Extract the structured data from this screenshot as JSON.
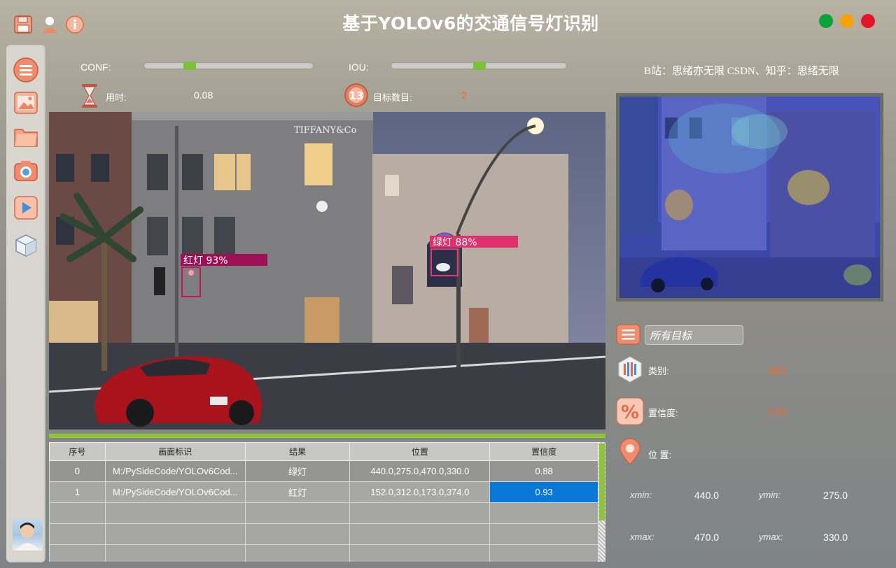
{
  "app": {
    "title": "基于YOLOv6的交通信号灯识别",
    "credits": "B站：思绪亦无限  CSDN、知乎：思绪无限"
  },
  "colors": {
    "accent_green": "#8dc43c",
    "value_orange": "#f06a28",
    "selection_blue": "#0a78d7",
    "window_close": "#e2152b",
    "window_min": "#f2a20c",
    "window_max": "#0aa23a"
  },
  "toolbar": {
    "icons": [
      "save-icon",
      "user-icon",
      "info-icon"
    ]
  },
  "sidebar": {
    "items": [
      {
        "name": "menu",
        "icon": "menu-icon"
      },
      {
        "name": "image",
        "icon": "image-icon"
      },
      {
        "name": "folder",
        "icon": "folder-icon"
      },
      {
        "name": "camera",
        "icon": "camera-icon"
      },
      {
        "name": "video",
        "icon": "play-icon"
      },
      {
        "name": "model",
        "icon": "cube-icon"
      }
    ]
  },
  "params": {
    "conf_label": "CONF:",
    "conf_value": 0.3,
    "iou_label": "IOU:",
    "iou_value": 0.5,
    "time_label": "用时:",
    "time_value": "0.08",
    "count_label": "目标数目:",
    "count_value": "2"
  },
  "detections": [
    {
      "label": "绿灯  88%"
    },
    {
      "label": "红灯  93%"
    }
  ],
  "table": {
    "headers": [
      "序号",
      "画面标识",
      "结果",
      "位置",
      "置信度"
    ],
    "rows": [
      [
        "0",
        "M:/PySideCode/YOLOv6Cod...",
        "绿灯",
        "440.0,275.0,470.0,330.0",
        "0.88"
      ],
      [
        "1",
        "M:/PySideCode/YOLOv6Cod...",
        "红灯",
        "152.0,312.0,173.0,374.0",
        "0.93"
      ]
    ]
  },
  "detail": {
    "target_select": "所有目标",
    "class_label": "类别:",
    "class_value": "绿灯",
    "conf_label": "置信度:",
    "conf_value": "0.88",
    "pos_label": "位 置:",
    "xmin_label": "xmin:",
    "xmin_value": "440.0",
    "ymin_label": "ymin:",
    "ymin_value": "275.0",
    "xmax_label": "xmax:",
    "xmax_value": "470.0",
    "ymax_label": "ymax:",
    "ymax_value": "330.0"
  }
}
